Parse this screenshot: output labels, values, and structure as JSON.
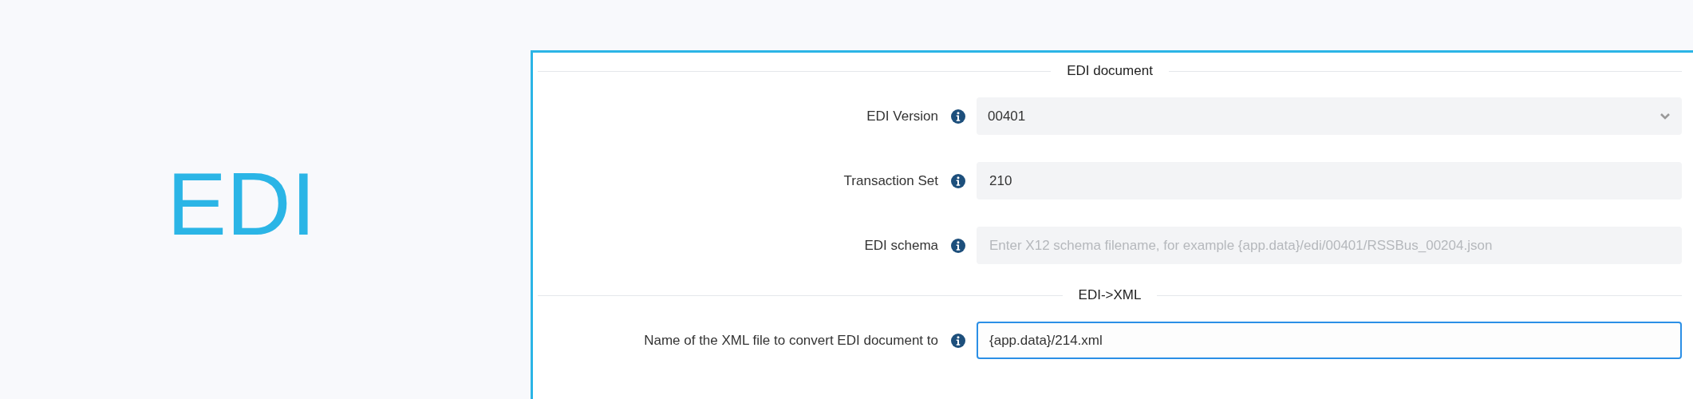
{
  "hero": {
    "title": "EDI"
  },
  "sections": [
    {
      "title": "EDI document",
      "fields": [
        {
          "label": "EDI Version",
          "kind": "select",
          "value": "00401",
          "focused": false
        },
        {
          "label": "Transaction Set",
          "kind": "text",
          "value": "210",
          "focused": false
        },
        {
          "label": "EDI schema",
          "kind": "text",
          "placeholder": "Enter X12 schema filename, for example {app.data}/edi/00401/RSSBus_00204.json",
          "focused": false
        }
      ]
    },
    {
      "title": "EDI->XML",
      "fields": [
        {
          "label": "Name of the XML file to convert EDI document to",
          "kind": "text",
          "value": "{app.data}/214.xml",
          "focused": true
        }
      ]
    }
  ]
}
